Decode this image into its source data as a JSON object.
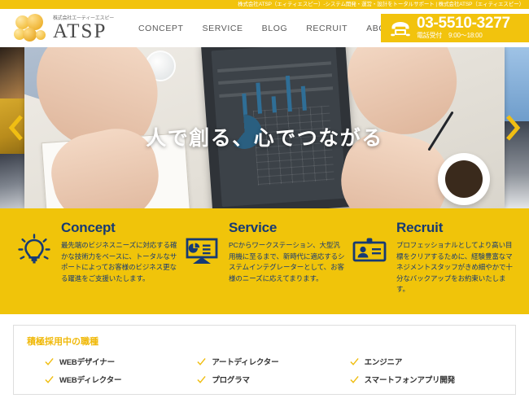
{
  "topbar": {
    "text": "株式会社ATSP（エィティエスピー）-システム開発・運営・設計をトータルサポート | 株式会社ATSP（エィティエスピー）"
  },
  "header": {
    "logo": {
      "kana": "株式会社エーティーエスピー",
      "name": "ATSP",
      "icon": "bubbles-logo-icon"
    },
    "nav": [
      {
        "label": "CONCEPT"
      },
      {
        "label": "SERVICE"
      },
      {
        "label": "BLOG"
      },
      {
        "label": "RECRUIT"
      },
      {
        "label": "ABOUT US"
      }
    ],
    "phone": {
      "icon": "telephone-icon",
      "number": "03-5510-3277",
      "hours": "電話受付　9:00〜18:00"
    }
  },
  "hero": {
    "headline": "人で創る、心でつながる",
    "prev_icon": "chevron-left-icon",
    "next_icon": "chevron-right-icon"
  },
  "features": [
    {
      "icon": "lightbulb-icon",
      "title": "Concept",
      "text": "最先端のビジネスニーズに対応する確かな技術力をベースに、トータルなサポートによってお客様のビジネス更なる躍進をご支援いたします。"
    },
    {
      "icon": "monitor-chart-icon",
      "title": "Service",
      "text": "PCからワークステーション、大型汎用機に至るまで、新時代に適応するシステムインテグレーターとして、お客様のニーズに応えてまります。"
    },
    {
      "icon": "id-card-icon",
      "title": "Recruit",
      "text": "プロフェッショナルとしてより高い目標をクリアするために、経験豊富なマネジメントスタッフがきめ細やかで十分なバックアップをお約束いたします。"
    }
  ],
  "recruit_card": {
    "title": "積極採用中の職種",
    "check_icon": "check-icon",
    "columns": [
      {
        "jobs": [
          {
            "label": "WEBデザイナー"
          },
          {
            "label": "WEBディレクター"
          }
        ]
      },
      {
        "jobs": [
          {
            "label": "アートディレクター"
          },
          {
            "label": "プログラマ"
          }
        ]
      },
      {
        "jobs": [
          {
            "label": "エンジニア"
          },
          {
            "label": "スマートフォンアプリ開発"
          }
        ]
      }
    ]
  },
  "colors": {
    "brand_yellow": "#F0C40A",
    "topbar_yellow": "#F2C30D",
    "heading_navy": "#163A74",
    "job_label": "#333333"
  }
}
